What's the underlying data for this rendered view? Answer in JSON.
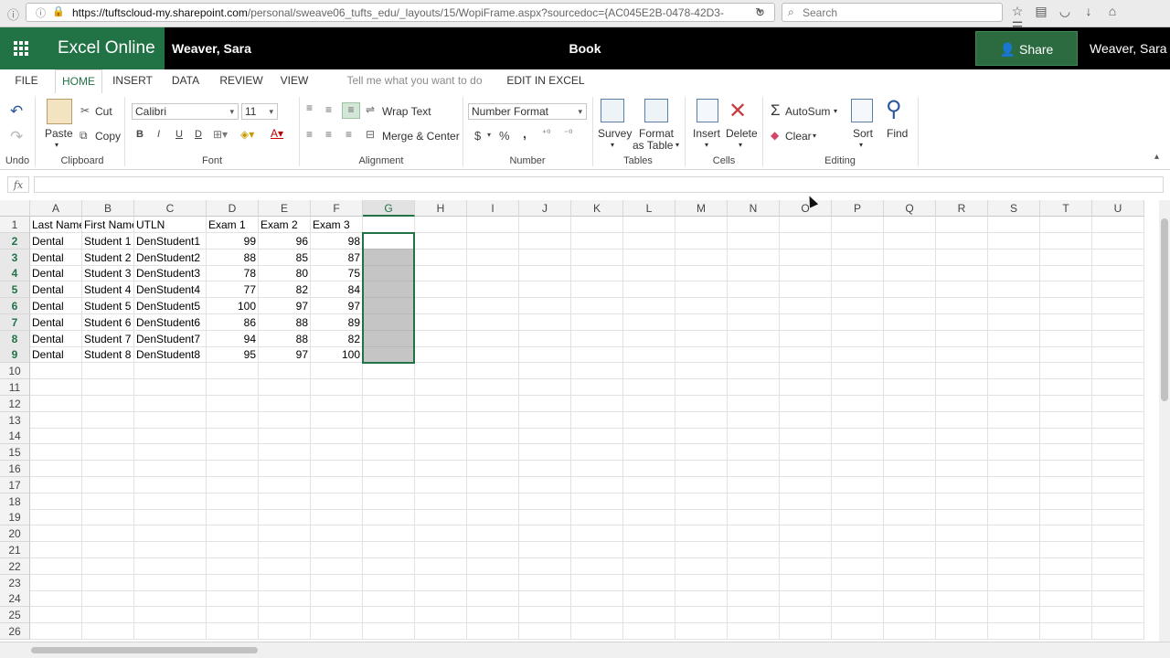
{
  "browser": {
    "url_host": "https://tuftscloud-my.sharepoint.com",
    "url_path": "/personal/sweave06_tufts_edu/_layouts/15/WopiFrame.aspx?sourcedoc={AC045E2B-0478-42D3-",
    "search_placeholder": "Search"
  },
  "appbar": {
    "app_name": "Excel Online",
    "owner": "Weaver, Sara",
    "book": "Book",
    "share": "Share",
    "user": "Weaver, Sara"
  },
  "tabs": [
    "FILE",
    "HOME",
    "INSERT",
    "DATA",
    "REVIEW",
    "VIEW",
    "Tell me what you want to do",
    "EDIT IN EXCEL"
  ],
  "ribbon": {
    "undo_label": "Undo",
    "paste": "Paste",
    "cut": "Cut",
    "copy": "Copy",
    "clipboard": "Clipboard",
    "font_name": "Calibri",
    "font_size": "11",
    "font": "Font",
    "bold": "B",
    "italic": "I",
    "underline": "U",
    "double_underline": "D",
    "wrap_text": "Wrap Text",
    "merge_center": "Merge & Center",
    "alignment": "Alignment",
    "number_format": "Number Format",
    "currency": "$",
    "percent": "%",
    "comma": ",",
    "number": "Number",
    "survey": "Survey",
    "format_as": "Format",
    "as_table": "as Table",
    "tables": "Tables",
    "insert": "Insert",
    "delete": "Delete",
    "cells": "Cells",
    "autosum": "AutoSum",
    "clear": "Clear",
    "sort": "Sort",
    "find": "Find",
    "editing": "Editing"
  },
  "formula": {
    "fx": "fx"
  },
  "sheet": {
    "columns": [
      "A",
      "B",
      "C",
      "D",
      "E",
      "F",
      "G",
      "H",
      "I",
      "J",
      "K",
      "L",
      "M",
      "N",
      "O",
      "P",
      "Q",
      "R",
      "S",
      "T",
      "U"
    ],
    "rows": [
      "1",
      "2",
      "3",
      "4",
      "5",
      "6",
      "7",
      "8",
      "9",
      "10",
      "11",
      "12",
      "13",
      "14",
      "15",
      "16",
      "17",
      "18",
      "19",
      "20",
      "21",
      "22",
      "23",
      "24",
      "25",
      "26"
    ],
    "header": [
      "Last Name",
      "First Name",
      "UTLN",
      "Exam 1",
      "Exam 2",
      "Exam 3"
    ],
    "data": [
      [
        "Dental",
        "Student 1",
        "DenStudent1",
        "99",
        "96",
        "98"
      ],
      [
        "Dental",
        "Student 2",
        "DenStudent2",
        "88",
        "85",
        "87"
      ],
      [
        "Dental",
        "Student 3",
        "DenStudent3",
        "78",
        "80",
        "75"
      ],
      [
        "Dental",
        "Student 4",
        "DenStudent4",
        "77",
        "82",
        "84"
      ],
      [
        "Dental",
        "Student 5",
        "DenStudent5",
        "100",
        "97",
        "97"
      ],
      [
        "Dental",
        "Student 6",
        "DenStudent6",
        "86",
        "88",
        "89"
      ],
      [
        "Dental",
        "Student 7",
        "DenStudent7",
        "94",
        "88",
        "82"
      ],
      [
        "Dental",
        "Student 8",
        "DenStudent8",
        "95",
        "97",
        "100"
      ]
    ],
    "selected_column": "G",
    "selected_range": "G2:G9"
  },
  "colors": {
    "excel_green": "#217346",
    "selection_fill": "#9a9a9a"
  }
}
